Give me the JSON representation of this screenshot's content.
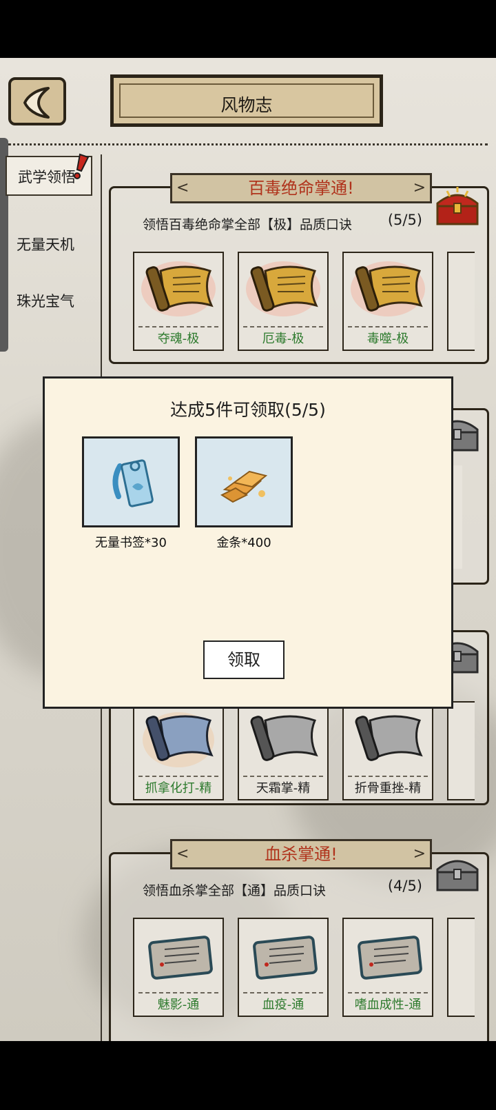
{
  "header": {
    "back_label": "",
    "title": "风物志"
  },
  "sidebar": {
    "items": [
      {
        "label": "武学领悟",
        "active": true
      },
      {
        "label": "无量天机",
        "active": false
      },
      {
        "label": "珠光宝气",
        "active": false
      }
    ]
  },
  "cards": [
    {
      "banner": "百毒绝命掌通!",
      "subtitle": "领悟百毒绝命掌全部【极】品质口诀",
      "count": "(5/5)",
      "chest": "red-treasure-chest",
      "items": [
        {
          "label": "夺魂-极",
          "icon": "gold-scroll-icon"
        },
        {
          "label": "厄毒-极",
          "icon": "gold-scroll-icon"
        },
        {
          "label": "毒噬-极",
          "icon": "gold-scroll-icon"
        }
      ]
    },
    {
      "banner": "",
      "subtitle": "",
      "count": "",
      "chest": "gray-treasure-chest",
      "items": [
        {
          "label": "抓拿化打-精",
          "icon": "blue-scroll-icon"
        },
        {
          "label": "天霜掌-精",
          "icon": "gray-scroll-icon"
        },
        {
          "label": "折骨重挫-精",
          "icon": "gray-scroll-icon"
        }
      ]
    },
    {
      "banner": "血杀掌通!",
      "subtitle": "领悟血杀掌全部【通】品质口诀",
      "count": "(4/5)",
      "chest": "gray-treasure-chest",
      "items": [
        {
          "label": "魅影-通",
          "icon": "stone-tablet-icon"
        },
        {
          "label": "血疫-通",
          "icon": "stone-tablet-icon"
        },
        {
          "label": "嗜血成性-通",
          "icon": "stone-tablet-icon"
        }
      ]
    }
  ],
  "modal": {
    "title": "达成5件可领取(5/5)",
    "rewards": [
      {
        "label": "无量书签*30",
        "icon": "bookmark-icon"
      },
      {
        "label": "金条*400",
        "icon": "gold-bars-icon"
      }
    ],
    "claim_label": "领取"
  },
  "colors": {
    "banner_text": "#b0331c",
    "unlocked_label": "#2d7a2d",
    "modal_bg": "#fbf3e1",
    "reward_bg": "#d9e7ee"
  }
}
